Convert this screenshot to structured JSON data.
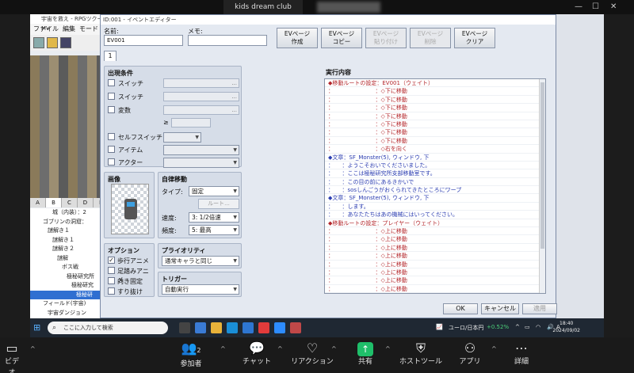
{
  "zoom": {
    "meeting_name": "kids dream club",
    "bottom": {
      "video": "ビデオ",
      "participants": "参加者",
      "participants_count": "2",
      "chat": "チャット",
      "reaction": "リアクション",
      "share": "共有",
      "host_tools": "ホストツール",
      "apps": "アプリ",
      "more": "詳細"
    }
  },
  "rpg": {
    "title": "宇宙を救え - RPGツクールMV",
    "menu": [
      "ファイル",
      "編集",
      "モード"
    ],
    "tile_tabs": [
      "A",
      "B",
      "C",
      "D",
      "R"
    ],
    "map_tree": [
      {
        "label": "城（内装）：2",
        "selected": false
      },
      {
        "label": "ゴブリンの洞窟：",
        "selected": false
      },
      {
        "label": "謎解き１",
        "selected": false
      },
      {
        "label": "謎解き１",
        "selected": false
      },
      {
        "label": "謎解き２",
        "selected": false
      },
      {
        "label": "謎解",
        "selected": false
      },
      {
        "label": "ボス戦",
        "selected": false
      },
      {
        "label": "極秘研究所",
        "selected": false
      },
      {
        "label": "極秘研究",
        "selected": false
      },
      {
        "label": "極秘研",
        "selected": true
      },
      {
        "label": "フィールド(宇宙)",
        "selected": false
      },
      {
        "label": "宇宙ダンジョン",
        "selected": false
      }
    ]
  },
  "dialog": {
    "title": "ID:001 - イベントエディター",
    "name_label": "名前:",
    "name_value": "EV001",
    "memo_label": "メモ:",
    "memo_value": "",
    "ev_buttons": [
      {
        "line1": "EVページ",
        "line2": "作成",
        "enabled": true
      },
      {
        "line1": "EVページ",
        "line2": "コピー",
        "enabled": true
      },
      {
        "line1": "EVページ",
        "line2": "貼り付け",
        "enabled": false
      },
      {
        "line1": "EVページ",
        "line2": "削除",
        "enabled": false
      },
      {
        "line1": "EVページ",
        "line2": "クリア",
        "enabled": true
      }
    ],
    "page_tab": "1",
    "conditions": {
      "title": "出現条件",
      "switch1": "スイッチ",
      "switch2": "スイッチ",
      "variable": "変数",
      "gte": "≥",
      "self_switch": "セルフスイッチ",
      "item": "アイテム",
      "actor": "アクター",
      "ellipsis": "..."
    },
    "image": {
      "title": "画像"
    },
    "autonomous": {
      "title": "自律移動",
      "type_label": "タイプ:",
      "type_value": "固定",
      "route_button": "ルート...",
      "speed_label": "速度:",
      "speed_value": "3: 1/2倍速",
      "freq_label": "頻度:",
      "freq_value": "5: 最高"
    },
    "options": {
      "title": "オプション",
      "walking": "歩行アニメ",
      "walking_checked": true,
      "stepping": "足踏みアニメ",
      "stepping_checked": false,
      "direction_fix": "向き固定",
      "direction_fix_checked": false,
      "through": "すり抜け",
      "through_checked": false
    },
    "priority": {
      "title": "プライオリティ",
      "value": "通常キャラと同じ"
    },
    "trigger": {
      "title": "トリガー",
      "value": "自動実行"
    },
    "contents": {
      "title": "実行内容",
      "lines": [
        {
          "text": "◆移動ルートの設定：EV001（ウェイト）",
          "color": "red"
        },
        {
          "text": "：　　　　　　　　：◇下に移動",
          "color": "red"
        },
        {
          "text": "：　　　　　　　　：◇下に移動",
          "color": "red"
        },
        {
          "text": "：　　　　　　　　：◇下に移動",
          "color": "red"
        },
        {
          "text": "：　　　　　　　　：◇下に移動",
          "color": "red"
        },
        {
          "text": "：　　　　　　　　：◇下に移動",
          "color": "red"
        },
        {
          "text": "：　　　　　　　　：◇下に移動",
          "color": "red"
        },
        {
          "text": "：　　　　　　　　：◇下に移動",
          "color": "red"
        },
        {
          "text": "：　　　　　　　　：◇右を向く",
          "color": "red"
        },
        {
          "text": "◆文章：SF_Monster(5), ウィンドウ, 下",
          "color": "blue"
        },
        {
          "text": "：　　：ようこそおいでくださいました。",
          "color": "blue"
        },
        {
          "text": "：　　：ここは極秘研究所支部移動室です。",
          "color": "blue"
        },
        {
          "text": "：　　：この目の前にあるきかいで",
          "color": "blue"
        },
        {
          "text": "：　　：sosしんごうがおくられてきたところにワープ",
          "color": "blue"
        },
        {
          "text": "◆文章：SF_Monster(5), ウィンドウ, 下",
          "color": "blue"
        },
        {
          "text": "：　　：します。",
          "color": "blue"
        },
        {
          "text": "：　　：あなたたちはあの機械にはいってください。",
          "color": "blue"
        },
        {
          "text": "◆移動ルートの設定：プレイヤー（ウェイト）",
          "color": "red"
        },
        {
          "text": "：　　　　　　　　：◇上に移動",
          "color": "red"
        },
        {
          "text": "：　　　　　　　　：◇上に移動",
          "color": "red"
        },
        {
          "text": "：　　　　　　　　：◇上に移動",
          "color": "red"
        },
        {
          "text": "：　　　　　　　　：◇上に移動",
          "color": "red"
        },
        {
          "text": "：　　　　　　　　：◇上に移動",
          "color": "red"
        },
        {
          "text": "：　　　　　　　　：◇上に移動",
          "color": "red"
        },
        {
          "text": "：　　　　　　　　：◇上に移動",
          "color": "red"
        },
        {
          "text": "：　　　　　　　　：◇上に移動",
          "color": "red"
        }
      ]
    },
    "ok": "OK",
    "cancel": "キャンセル",
    "apply": "適用"
  },
  "taskbar": {
    "search_placeholder": "ここに入力して検索",
    "stock": "ユーロ/日本円",
    "stock_change": "+0.52%",
    "ime": "A",
    "time": "18:40",
    "date": "2024/09/02"
  }
}
